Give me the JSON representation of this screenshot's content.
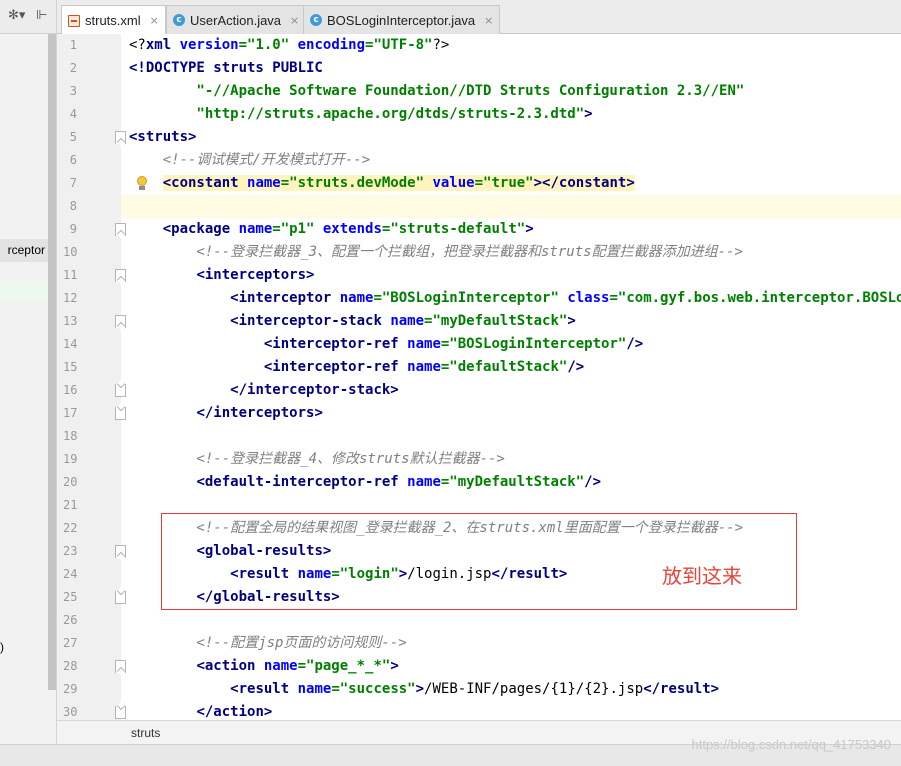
{
  "left_panel": {
    "toolbar_gear": "✻▾",
    "toolbar_split": "⊩",
    "selected_item": "rceptor",
    "partial_paren": ")"
  },
  "tabs": [
    {
      "label": "struts.xml",
      "icon": "xml-file-icon",
      "active": true
    },
    {
      "label": "UserAction.java",
      "icon": "java-class-icon",
      "active": false
    },
    {
      "label": "BOSLoginInterceptor.java",
      "icon": "java-class-icon",
      "active": false
    }
  ],
  "tab_close": "×",
  "class_icon_letter": "c",
  "breadcrumb": "struts",
  "annotation_text": "放到这来",
  "watermark": "https://blog.csdn.net/qq_41753340",
  "code_lines": [
    {
      "n": "1",
      "fold": "",
      "html": "<span class=\"pl\">&lt;?</span><span class=\"t\">xml </span><span class=\"a\">version</span><span class=\"s\">=\"1.0\" </span><span class=\"a\">encoding</span><span class=\"s\">=\"UTF-8\"</span><span class=\"pl\">?&gt;</span>"
    },
    {
      "n": "2",
      "fold": "",
      "html": "<span class=\"t\">&lt;!DOCTYPE struts PUBLIC</span>"
    },
    {
      "n": "3",
      "fold": "",
      "html": "<span class=\"s\">        \"-//Apache Software Foundation//DTD Struts Configuration 2.3//EN\"</span>"
    },
    {
      "n": "4",
      "fold": "",
      "html": "<span class=\"s\">        \"http://struts.apache.org/dtds/struts-2.3.dtd\"</span><span class=\"t\">&gt;</span>"
    },
    {
      "n": "5",
      "fold": "o",
      "html": "<span class=\"t\">&lt;struts&gt;</span>"
    },
    {
      "n": "6",
      "fold": "",
      "html": "<span class=\"c\">    &lt;!--调试模式/开发模式打开--&gt;</span>"
    },
    {
      "n": "7",
      "fold": "",
      "bulb": true,
      "html": "    <span class=\"hlbox\"><span class=\"t\">&lt;constant </span><span class=\"a\">name</span><span class=\"s\">=\"struts.devMode\" </span><span class=\"a\">value</span><span class=\"s\">=\"true\"</span><span class=\"t\">&gt;&lt;/constant&gt;</span></span>"
    },
    {
      "n": "8",
      "fold": "",
      "hl": true,
      "html": ""
    },
    {
      "n": "9",
      "fold": "o",
      "html": "    <span class=\"t\">&lt;package </span><span class=\"a\">name</span><span class=\"s\">=\"p1\" </span><span class=\"a\">extends</span><span class=\"s\">=\"struts-default\"</span><span class=\"t\">&gt;</span>"
    },
    {
      "n": "10",
      "fold": "",
      "html": "<span class=\"c\">        &lt;!--登录拦截器_3、配置一个拦截组，把登录拦截器和struts配置拦截器添加进组--&gt;</span>"
    },
    {
      "n": "11",
      "fold": "o",
      "html": "        <span class=\"t\">&lt;interceptors&gt;</span>"
    },
    {
      "n": "12",
      "fold": "",
      "html": "            <span class=\"t\">&lt;interceptor </span><span class=\"a\">name</span><span class=\"s\">=\"BOSLoginInterceptor\" </span><span class=\"a\">class</span><span class=\"s\">=\"com.gyf.bos.web.interceptor.BOSLoginInterceptor\"</span>"
    },
    {
      "n": "13",
      "fold": "o",
      "html": "            <span class=\"t\">&lt;interceptor-stack </span><span class=\"a\">name</span><span class=\"s\">=\"myDefaultStack\"</span><span class=\"t\">&gt;</span>"
    },
    {
      "n": "14",
      "fold": "",
      "html": "                <span class=\"t\">&lt;interceptor-ref </span><span class=\"a\">name</span><span class=\"s\">=\"BOSLoginInterceptor\"</span><span class=\"t\">/&gt;</span>"
    },
    {
      "n": "15",
      "fold": "",
      "html": "                <span class=\"t\">&lt;interceptor-ref </span><span class=\"a\">name</span><span class=\"s\">=\"defaultStack\"</span><span class=\"t\">/&gt;</span>"
    },
    {
      "n": "16",
      "fold": "c",
      "html": "            <span class=\"t\">&lt;/interceptor-stack&gt;</span>"
    },
    {
      "n": "17",
      "fold": "c",
      "html": "        <span class=\"t\">&lt;/interceptors&gt;</span>"
    },
    {
      "n": "18",
      "fold": "",
      "html": ""
    },
    {
      "n": "19",
      "fold": "",
      "html": "<span class=\"c\">        &lt;!--登录拦截器_4、修改struts默认拦截器--&gt;</span>"
    },
    {
      "n": "20",
      "fold": "",
      "html": "        <span class=\"t\">&lt;default-interceptor-ref </span><span class=\"a\">name</span><span class=\"s\">=\"myDefaultStack\"</span><span class=\"t\">/&gt;</span>"
    },
    {
      "n": "21",
      "fold": "",
      "html": ""
    },
    {
      "n": "22",
      "fold": "",
      "html": "<span class=\"c\">        &lt;!--配置全局的结果视图_登录拦截器_2、在struts.xml里面配置一个登录拦截器--&gt;</span>"
    },
    {
      "n": "23",
      "fold": "o",
      "html": "        <span class=\"t\">&lt;global-results&gt;</span>"
    },
    {
      "n": "24",
      "fold": "",
      "html": "            <span class=\"t\">&lt;result </span><span class=\"a\">name</span><span class=\"s\">=\"login\"</span><span class=\"t\">&gt;</span><span class=\"pl\">/login.jsp</span><span class=\"t\">&lt;/result&gt;</span>"
    },
    {
      "n": "25",
      "fold": "c",
      "html": "        <span class=\"t\">&lt;/global-results&gt;</span>"
    },
    {
      "n": "26",
      "fold": "",
      "html": ""
    },
    {
      "n": "27",
      "fold": "",
      "html": "<span class=\"c\">        &lt;!--配置jsp页面的访问规则--&gt;</span>"
    },
    {
      "n": "28",
      "fold": "o",
      "html": "        <span class=\"t\">&lt;action </span><span class=\"a\">name</span><span class=\"s\">=\"page_*_*\"</span><span class=\"t\">&gt;</span>"
    },
    {
      "n": "29",
      "fold": "",
      "html": "            <span class=\"t\">&lt;result </span><span class=\"a\">name</span><span class=\"s\">=\"success\"</span><span class=\"t\">&gt;</span><span class=\"pl\">/WEB-INF/pages/{1}/{2}.jsp</span><span class=\"t\">&lt;/result&gt;</span>"
    },
    {
      "n": "30",
      "fold": "c",
      "html": "        <span class=\"t\">&lt;/action&gt;</span>"
    }
  ]
}
